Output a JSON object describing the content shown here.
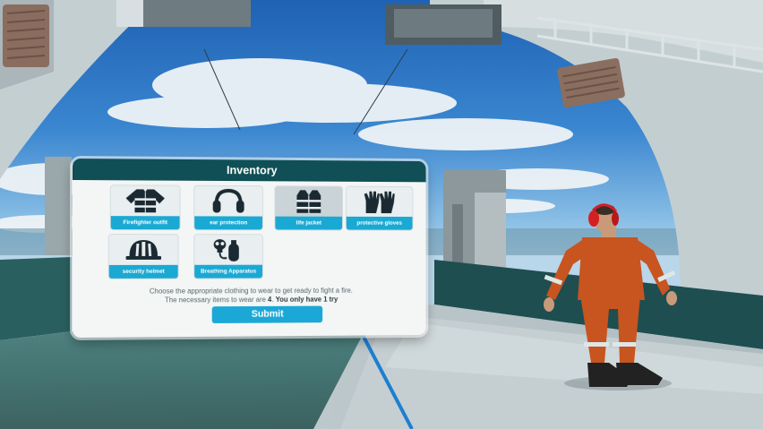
{
  "inventory": {
    "title": "Inventory",
    "items": [
      {
        "label": "Firefighter outfit",
        "icon": "firefighter-outfit-icon",
        "selected": false
      },
      {
        "label": "ear protection",
        "icon": "ear-protection-icon",
        "selected": false
      },
      {
        "label": "life jacket",
        "icon": "life-jacket-icon",
        "selected": true
      },
      {
        "label": "protective gloves",
        "icon": "protective-gloves-icon",
        "selected": false
      },
      {
        "label": "security helmet",
        "icon": "security-helmet-icon",
        "selected": false
      },
      {
        "label": "Breathing Apparatus",
        "icon": "breathing-apparatus-icon",
        "selected": false
      }
    ],
    "instructions": {
      "line1": "Choose the appropriate clothing to wear to get ready to fight a fire.",
      "line2_prefix": "The necessary items to wear are ",
      "line2_count": "4",
      "line2_mid": ". ",
      "line2_emphasis": "You only have 1 try"
    },
    "submit_label": "Submit"
  },
  "colors": {
    "header": "#0f4f55",
    "label_bg": "#1aa9d3",
    "button": "#1ca8d6",
    "pointer_ray": "#1d7fd0",
    "coverall": "#c8541f"
  }
}
